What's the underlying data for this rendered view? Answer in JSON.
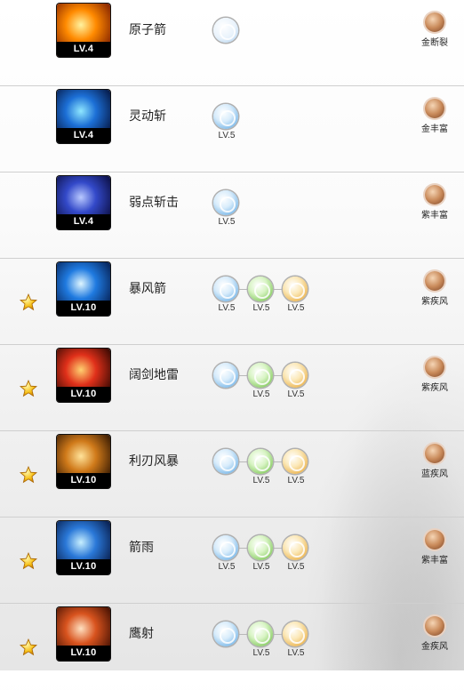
{
  "skills": [
    {
      "level": "LV.4",
      "name": "原子箭",
      "starred": false,
      "art": [
        "#fff3a0",
        "#ff8a00",
        "#7a1a00"
      ],
      "runes": [
        {
          "color": "ghost",
          "lv": ""
        }
      ],
      "gem": "金断裂"
    },
    {
      "level": "LV.4",
      "name": "灵动斩",
      "starred": false,
      "art": [
        "#8fe7ff",
        "#1c6fd6",
        "#04123a"
      ],
      "runes": [
        {
          "color": "blue",
          "lv": "LV.5"
        }
      ],
      "gem": "金丰富"
    },
    {
      "level": "LV.4",
      "name": "弱点斩击",
      "starred": false,
      "art": [
        "#b9c9ff",
        "#3349c9",
        "#090b3a"
      ],
      "runes": [
        {
          "color": "blue",
          "lv": "LV.5"
        }
      ],
      "gem": "紫丰富"
    },
    {
      "level": "LV.10",
      "name": "暴风箭",
      "starred": true,
      "art": [
        "#dff6ff",
        "#1f7ae0",
        "#041a4a"
      ],
      "runes": [
        {
          "color": "blue",
          "lv": "LV.5"
        },
        {
          "color": "green",
          "lv": "LV.5"
        },
        {
          "color": "gold",
          "lv": "LV.5"
        }
      ],
      "gem": "紫疾风"
    },
    {
      "level": "LV.10",
      "name": "阔剑地雷",
      "starred": true,
      "art": [
        "#ffd070",
        "#e0301a",
        "#2a0600"
      ],
      "runes": [
        {
          "color": "blue",
          "lv": ""
        },
        {
          "color": "green",
          "lv": "LV.5"
        },
        {
          "color": "gold",
          "lv": "LV.5"
        }
      ],
      "gem": "紫疾风"
    },
    {
      "level": "LV.10",
      "name": "利刃风暴",
      "starred": true,
      "art": [
        "#ffe39a",
        "#d07a1a",
        "#2a1200"
      ],
      "runes": [
        {
          "color": "blue",
          "lv": ""
        },
        {
          "color": "green",
          "lv": "LV.5"
        },
        {
          "color": "gold",
          "lv": "LV.5"
        }
      ],
      "gem": "蓝疾风"
    },
    {
      "level": "LV.10",
      "name": "箭雨",
      "starred": true,
      "art": [
        "#c7efff",
        "#2a78d8",
        "#061640"
      ],
      "runes": [
        {
          "color": "blue",
          "lv": "LV.5"
        },
        {
          "color": "green",
          "lv": "LV.5"
        },
        {
          "color": "gold",
          "lv": "LV.5"
        }
      ],
      "gem": "紫丰富"
    },
    {
      "level": "LV.10",
      "name": "鹰射",
      "starred": true,
      "art": [
        "#ffe0c0",
        "#d8531e",
        "#3a0c00"
      ],
      "runes": [
        {
          "color": "blue",
          "lv": ""
        },
        {
          "color": "green",
          "lv": "LV.5"
        },
        {
          "color": "gold",
          "lv": "LV.5"
        }
      ],
      "gem": "金疾风"
    }
  ]
}
